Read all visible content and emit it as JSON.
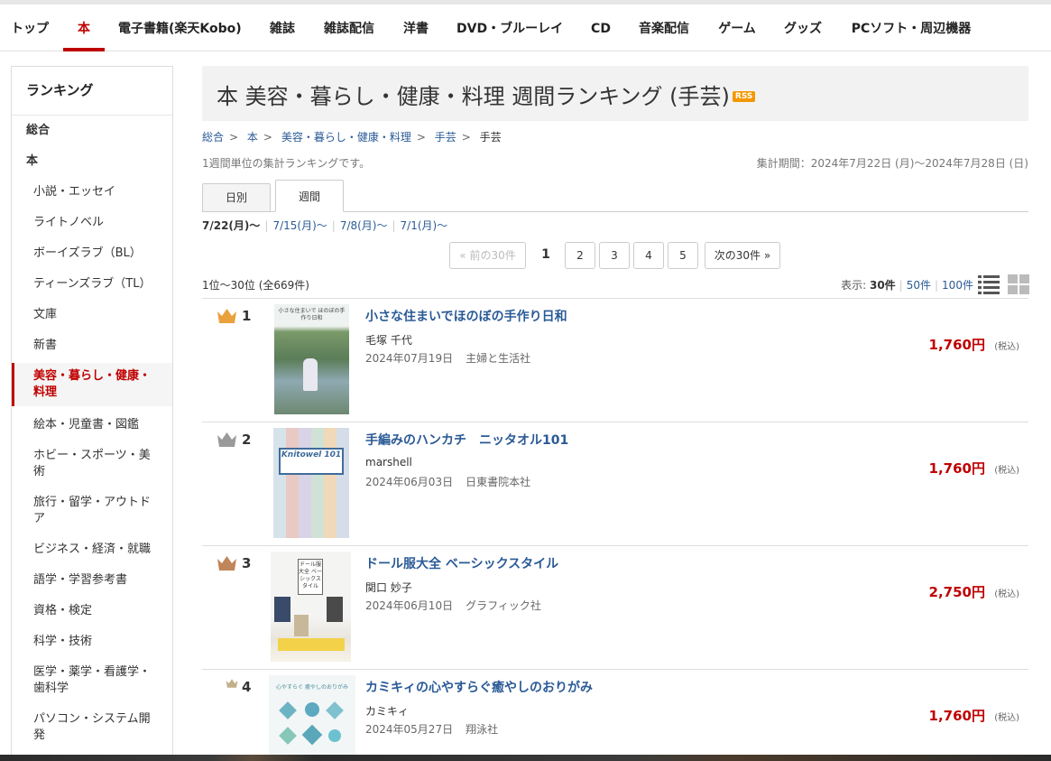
{
  "nav": {
    "items": [
      "トップ",
      "本",
      "電子書籍(楽天Kobo)",
      "雑誌",
      "雑誌配信",
      "洋書",
      "DVD・ブルーレイ",
      "CD",
      "音楽配信",
      "ゲーム",
      "グッズ",
      "PCソフト・周辺機器"
    ],
    "active": "本"
  },
  "sidebar": {
    "heading": "ランキング",
    "items": [
      "総合",
      "本",
      "小説・エッセイ",
      "ライトノベル",
      "ボーイズラブ（BL）",
      "ティーンズラブ（TL）",
      "文庫",
      "新書",
      "美容・暮らし・健康・料理",
      "絵本・児童書・図鑑",
      "ホビー・スポーツ・美術",
      "旅行・留学・アウトドア",
      "ビジネス・経済・就職",
      "語学・学習参考書",
      "資格・検定",
      "科学・技術",
      "医学・薬学・看護学・歯科学",
      "パソコン・システム開発"
    ]
  },
  "page": {
    "title": "本  美容・暮らし・健康・料理  週間ランキング  (手芸)",
    "rss": "RSS",
    "breadcrumb": [
      "総合",
      "本",
      "美容・暮らし・健康・料理",
      "手芸",
      "手芸"
    ],
    "breadcrumb_sep": ">",
    "description": "1週間単位の集計ランキングです。",
    "period": "集計期間：2024年7月22日 (月)～2024年7月28日 (日)",
    "tabs": [
      "日別",
      "週間"
    ],
    "active_tab": "週間",
    "weeks": [
      "7/22(月)～",
      "7/15(月)～",
      "7/8(月)～",
      "7/1(月)～"
    ],
    "pager": {
      "prev": "« 前の30件",
      "pages": [
        "1",
        "2",
        "3",
        "4",
        "5"
      ],
      "current": "1",
      "next": "次の30件 »"
    },
    "range": "1位～30位 (全669件)",
    "display_label": "表示:",
    "display_options": [
      "30件",
      "50件",
      "100件"
    ],
    "display_current": "30件"
  },
  "books": [
    {
      "rank": "1",
      "title": "小さな住まいでほのぼの手作り日和",
      "author": "毛塚 千代",
      "date": "2024年07月19日",
      "publisher": "主婦と生活社",
      "price": "1,760円",
      "tax": "(税込)",
      "crown": "gold",
      "cover_text": "小さな住まいで ほのぼの手作り日和"
    },
    {
      "rank": "2",
      "title": "手編みのハンカチ　ニッタオル101",
      "author": "marshell",
      "date": "2024年06月03日",
      "publisher": "日東書院本社",
      "price": "1,760円",
      "tax": "(税込)",
      "crown": "silver",
      "cover_text": "Knitowel 101"
    },
    {
      "rank": "3",
      "title": "ドール服大全 ベーシックスタイル",
      "author": "関口 妙子",
      "date": "2024年06月10日",
      "publisher": "グラフィック社",
      "price": "2,750円",
      "tax": "(税込)",
      "crown": "bronze",
      "cover_text": "ドール服大全 ベーシックスタイル"
    },
    {
      "rank": "4",
      "title": "カミキィの心やすらぐ癒やしのおりがみ",
      "author": "カミキィ",
      "date": "2024年05月27日",
      "publisher": "翔泳社",
      "price": "1,760円",
      "tax": "(税込)",
      "crown": "plain",
      "cover_text": "心やすらぐ 癒やしのおりがみ"
    }
  ],
  "colors": {
    "accent": "#bf0000",
    "link": "#2a5a96",
    "gold": "#e9a23b",
    "silver": "#9a9a9a",
    "bronze": "#c08659",
    "plain": "#c2b08a"
  }
}
